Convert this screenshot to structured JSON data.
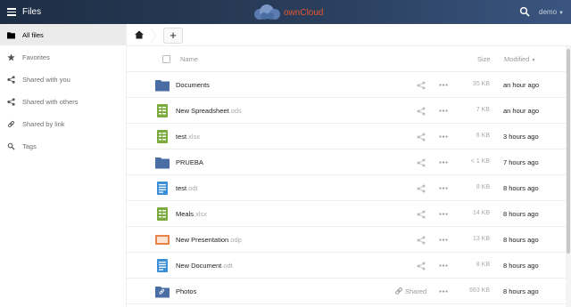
{
  "header": {
    "app_title": "Files",
    "logo_text": "ownCloud",
    "user": "demo",
    "colors": {
      "brand": "#1d2d44",
      "logo_accent": "#e8542c",
      "folder": "#4a6ea3"
    }
  },
  "sidebar": {
    "items": [
      {
        "label": "All files",
        "icon": "folder-icon",
        "active": true
      },
      {
        "label": "Favorites",
        "icon": "star-icon",
        "active": false
      },
      {
        "label": "Shared with you",
        "icon": "share-icon",
        "active": false
      },
      {
        "label": "Shared with others",
        "icon": "share-icon",
        "active": false
      },
      {
        "label": "Shared by link",
        "icon": "link-icon",
        "active": false
      },
      {
        "label": "Tags",
        "icon": "tag-icon",
        "active": false
      }
    ]
  },
  "controls": {
    "new_label": "+"
  },
  "table": {
    "headers": {
      "name": "Name",
      "size": "Size",
      "modified": "Modified"
    },
    "rows": [
      {
        "name": "Documents",
        "ext": "",
        "type": "folder",
        "size": "35 KB",
        "modified": "an hour ago",
        "shared_label": ""
      },
      {
        "name": "New Spreadsheet",
        "ext": ".ods",
        "type": "spreadsheet",
        "size": "7 KB",
        "modified": "an hour ago",
        "shared_label": ""
      },
      {
        "name": "test",
        "ext": ".xlsx",
        "type": "spreadsheet",
        "size": "6 KB",
        "modified": "3 hours ago",
        "shared_label": ""
      },
      {
        "name": "PRUEBA",
        "ext": "",
        "type": "folder",
        "size": "< 1 KB",
        "modified": "7 hours ago",
        "shared_label": ""
      },
      {
        "name": "test",
        "ext": ".odt",
        "type": "document",
        "size": "8 KB",
        "modified": "8 hours ago",
        "shared_label": ""
      },
      {
        "name": "Meals",
        "ext": ".xlsx",
        "type": "spreadsheet",
        "size": "14 KB",
        "modified": "8 hours ago",
        "shared_label": ""
      },
      {
        "name": "New Presentation",
        "ext": ".odp",
        "type": "presentation",
        "size": "13 KB",
        "modified": "8 hours ago",
        "shared_label": ""
      },
      {
        "name": "New Document",
        "ext": ".odt",
        "type": "document",
        "size": "8 KB",
        "modified": "8 hours ago",
        "shared_label": ""
      },
      {
        "name": "Photos",
        "ext": "",
        "type": "shared-folder",
        "size": "663 KB",
        "modified": "8 hours ago",
        "shared_label": "Shared"
      }
    ]
  }
}
